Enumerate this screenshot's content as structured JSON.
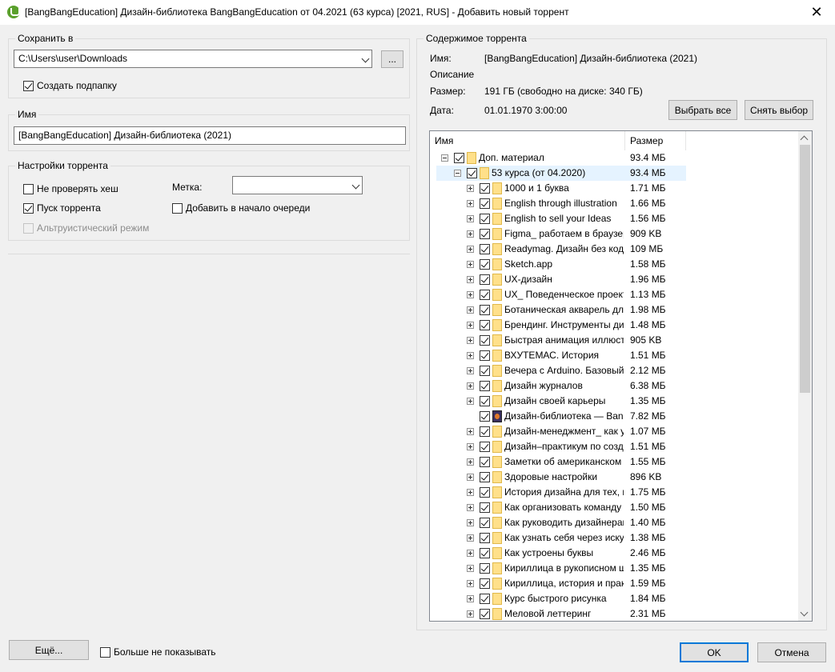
{
  "window": {
    "title": "[BangBangEducation] Дизайн-библиотека BangBangEducation от 04.2021 (63 курса) [2021, RUS] - Добавить новый торрент",
    "close_glyph": "✕"
  },
  "save": {
    "legend": "Сохранить в",
    "path": "C:\\Users\\user\\Downloads",
    "browse_label": "...",
    "subfolder_label": "Создать подпапку",
    "subfolder_checked": true
  },
  "name": {
    "legend": "Имя",
    "value": "[BangBangEducation] Дизайн-библиотека (2021)"
  },
  "settings": {
    "legend": "Настройки торрента",
    "skip_hash_label": "Не проверять хеш",
    "start_label": "Пуск торрента",
    "altruistic_label": "Альтруистический режим",
    "label_caption": "Метка:",
    "label_value": "",
    "add_top_label": "Добавить в начало очереди"
  },
  "content": {
    "legend": "Содержимое торрента",
    "name_caption": "Имя:",
    "name_value": "[BangBangEducation] Дизайн-библиотека (2021)",
    "description_caption": "Описание",
    "size_caption": "Размер:",
    "size_value": "191 ГБ (свободно на диске: 340 ГБ)",
    "date_caption": "Дата:",
    "date_value": "01.01.1970 3:00:00",
    "select_all_label": "Выбрать все",
    "deselect_label": "Снять выбор"
  },
  "tree": {
    "columns": [
      "Имя",
      "Размер"
    ],
    "rows": [
      {
        "name": "Доп. материал",
        "size": "93.4 МБ",
        "level": 0,
        "expander": "minus",
        "icon": "folder"
      },
      {
        "name": "53 курса (от 04.2020)",
        "size": "93.4 МБ",
        "level": 1,
        "expander": "minus",
        "icon": "folder",
        "selected": true
      },
      {
        "name": "1000 и 1 буква",
        "size": "1.71 МБ",
        "level": 2,
        "expander": "plus",
        "icon": "folder"
      },
      {
        "name": "English through illustration",
        "size": "1.66 МБ",
        "level": 2,
        "expander": "plus",
        "icon": "folder"
      },
      {
        "name": "English to sell your Ideas",
        "size": "1.56 МБ",
        "level": 2,
        "expander": "plus",
        "icon": "folder"
      },
      {
        "name": "Figma_ работаем в браузере",
        "size": "909 KB",
        "level": 2,
        "expander": "plus",
        "icon": "folder"
      },
      {
        "name": "Readymag. Дизайн без кода",
        "size": "109 МБ",
        "level": 2,
        "expander": "plus",
        "icon": "folder"
      },
      {
        "name": "Sketch.app",
        "size": "1.58 МБ",
        "level": 2,
        "expander": "plus",
        "icon": "folder"
      },
      {
        "name": "UX-дизайн",
        "size": "1.96 МБ",
        "level": 2,
        "expander": "plus",
        "icon": "folder"
      },
      {
        "name": "UX_ Поведенческое проектирование",
        "size": "1.13 МБ",
        "level": 2,
        "expander": "plus",
        "icon": "folder"
      },
      {
        "name": "Ботаническая акварель для начинающих",
        "size": "1.98 МБ",
        "level": 2,
        "expander": "plus",
        "icon": "folder"
      },
      {
        "name": "Брендинг. Инструменты дизайнера",
        "size": "1.48 МБ",
        "level": 2,
        "expander": "plus",
        "icon": "folder"
      },
      {
        "name": "Быстрая анимация иллюстраций",
        "size": "905 KB",
        "level": 2,
        "expander": "plus",
        "icon": "folder"
      },
      {
        "name": "ВХУТЕМАС. История",
        "size": "1.51 МБ",
        "level": 2,
        "expander": "plus",
        "icon": "folder"
      },
      {
        "name": "Вечера с Arduino. Базовый курс",
        "size": "2.12 МБ",
        "level": 2,
        "expander": "plus",
        "icon": "folder"
      },
      {
        "name": "Дизайн журналов",
        "size": "6.38 МБ",
        "level": 2,
        "expander": "plus",
        "icon": "folder"
      },
      {
        "name": "Дизайн своей карьеры",
        "size": "1.35 МБ",
        "level": 2,
        "expander": "plus",
        "icon": "folder"
      },
      {
        "name": "Дизайн-библиотека — BangBangEducation",
        "size": "7.82 МБ",
        "level": 2,
        "expander": "none",
        "icon": "file"
      },
      {
        "name": "Дизайн-менеджмент_ как управлять",
        "size": "1.07 МБ",
        "level": 2,
        "expander": "plus",
        "icon": "folder"
      },
      {
        "name": "Дизайн–практикум по созданию",
        "size": "1.51 МБ",
        "level": 2,
        "expander": "plus",
        "icon": "folder"
      },
      {
        "name": "Заметки об американском дизайне",
        "size": "1.55 МБ",
        "level": 2,
        "expander": "plus",
        "icon": "folder"
      },
      {
        "name": "Здоровые настройки",
        "size": "896 KB",
        "level": 2,
        "expander": "plus",
        "icon": "folder"
      },
      {
        "name": "История дизайна для тех, кто",
        "size": "1.75 МБ",
        "level": 2,
        "expander": "plus",
        "icon": "folder"
      },
      {
        "name": "Как организовать команду",
        "size": "1.50 МБ",
        "level": 2,
        "expander": "plus",
        "icon": "folder"
      },
      {
        "name": "Как руководить дизайнерами",
        "size": "1.40 МБ",
        "level": 2,
        "expander": "plus",
        "icon": "folder"
      },
      {
        "name": "Как узнать себя через искусство",
        "size": "1.38 МБ",
        "level": 2,
        "expander": "plus",
        "icon": "folder"
      },
      {
        "name": "Как устроены буквы",
        "size": "2.46 МБ",
        "level": 2,
        "expander": "plus",
        "icon": "folder"
      },
      {
        "name": "Кириллица в рукописном шрифте",
        "size": "1.35 МБ",
        "level": 2,
        "expander": "plus",
        "icon": "folder"
      },
      {
        "name": "Кириллица, история и практика",
        "size": "1.59 МБ",
        "level": 2,
        "expander": "plus",
        "icon": "folder"
      },
      {
        "name": "Курс быстрого рисунка",
        "size": "1.84 МБ",
        "level": 2,
        "expander": "plus",
        "icon": "folder"
      },
      {
        "name": "Меловой леттеринг",
        "size": "2.31 МБ",
        "level": 2,
        "expander": "plus",
        "icon": "folder"
      }
    ]
  },
  "footer": {
    "more_label": "Ещё...",
    "dont_show_label": "Больше не показывать",
    "ok_label": "OK",
    "cancel_label": "Отмена"
  },
  "colors": {
    "accent": "#0078d7",
    "selection": "#e5f3ff",
    "folder": "#ffe08a"
  }
}
